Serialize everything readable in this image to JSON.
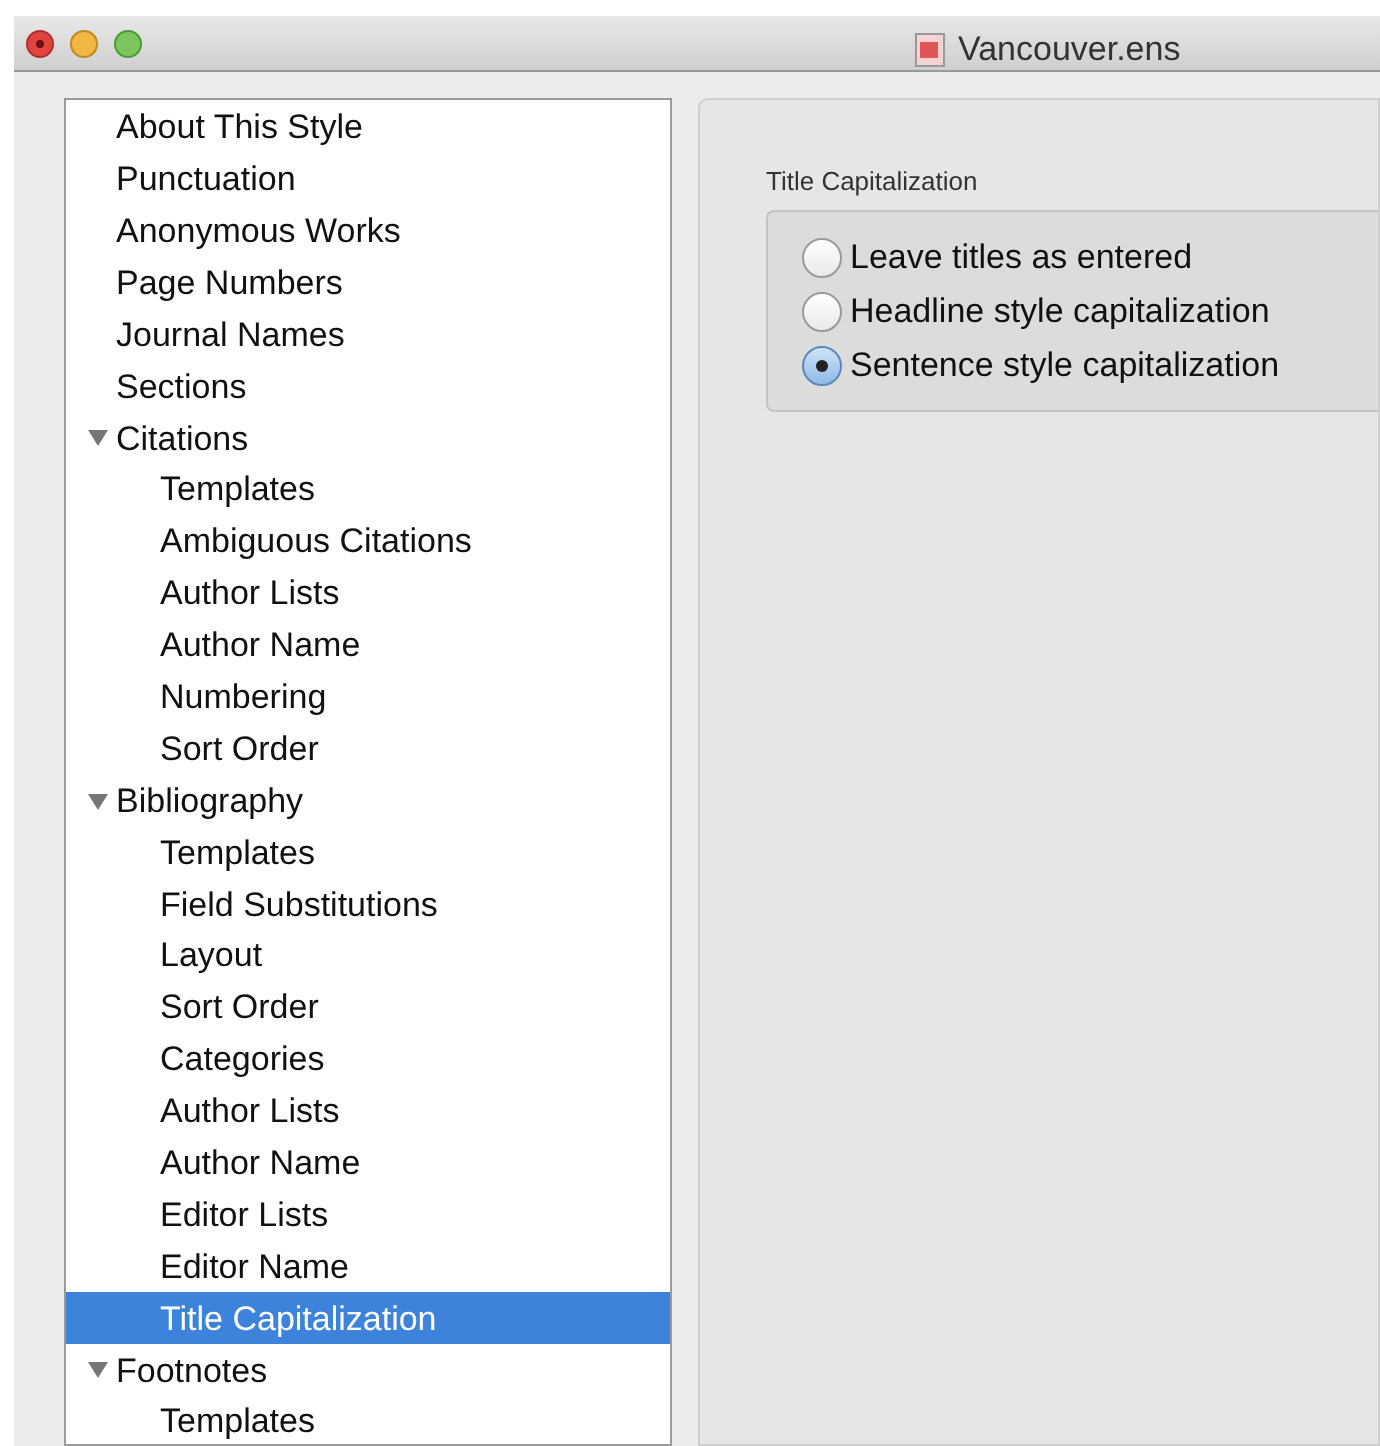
{
  "window": {
    "title": "Vancouver.ens"
  },
  "sidebar": {
    "items": [
      {
        "label": "About This Style",
        "selected": false
      },
      {
        "label": "Punctuation",
        "selected": false
      },
      {
        "label": "Anonymous Works",
        "selected": false
      },
      {
        "label": "Page Numbers",
        "selected": false
      },
      {
        "label": "Journal Names",
        "selected": false
      },
      {
        "label": "Sections",
        "selected": false
      },
      {
        "label": "Citations",
        "selected": false,
        "expanded": true,
        "children": [
          {
            "label": "Templates",
            "selected": false
          },
          {
            "label": "Ambiguous Citations",
            "selected": false
          },
          {
            "label": "Author Lists",
            "selected": false
          },
          {
            "label": "Author Name",
            "selected": false
          },
          {
            "label": "Numbering",
            "selected": false
          },
          {
            "label": "Sort Order",
            "selected": false
          }
        ]
      },
      {
        "label": "Bibliography",
        "selected": false,
        "expanded": true,
        "children": [
          {
            "label": "Templates",
            "selected": false
          },
          {
            "label": "Field Substitutions",
            "selected": false
          },
          {
            "label": "Layout",
            "selected": false
          },
          {
            "label": "Sort Order",
            "selected": false
          },
          {
            "label": "Categories",
            "selected": false
          },
          {
            "label": "Author Lists",
            "selected": false
          },
          {
            "label": "Author Name",
            "selected": false
          },
          {
            "label": "Editor Lists",
            "selected": false
          },
          {
            "label": "Editor Name",
            "selected": false
          },
          {
            "label": "Title Capitalization",
            "selected": true
          }
        ]
      },
      {
        "label": "Footnotes",
        "selected": false,
        "expanded": true,
        "children": [
          {
            "label": "Templates",
            "selected": false
          }
        ]
      }
    ]
  },
  "panel": {
    "group_title": "Title Capitalization",
    "options": [
      {
        "label": "Leave titles as entered",
        "selected": false
      },
      {
        "label": "Headline style capitalization",
        "selected": false
      },
      {
        "label": "Sentence style capitalization",
        "selected": true
      }
    ]
  }
}
